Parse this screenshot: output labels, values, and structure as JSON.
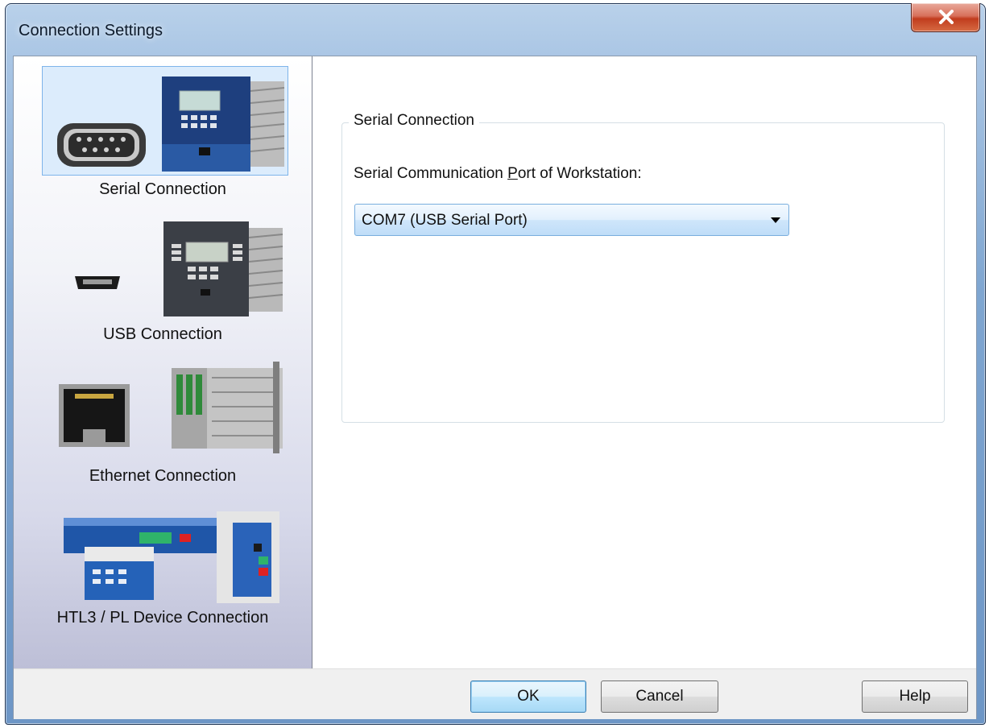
{
  "window": {
    "title": "Connection Settings"
  },
  "sidebar": {
    "items": [
      {
        "label": "Serial Connection",
        "selected": true,
        "icons": [
          "db9-connector-icon",
          "protection-relay-device-icon"
        ]
      },
      {
        "label": "USB Connection",
        "selected": false,
        "icons": [
          "mini-usb-connector-icon",
          "protection-relay-device-icon"
        ]
      },
      {
        "label": "Ethernet Connection",
        "selected": false,
        "icons": [
          "rj45-port-icon",
          "modular-relay-rack-icon"
        ]
      },
      {
        "label": "HTL3 / PL Device Connection",
        "selected": false,
        "icons": [
          "htl3-device-group-icon"
        ]
      }
    ]
  },
  "main": {
    "group_title": "Serial Connection",
    "port_label": "Serial Communication Port of Workstation:",
    "port_value": "COM7 (USB Serial Port)"
  },
  "footer": {
    "ok": "OK",
    "cancel": "Cancel",
    "help": "Help"
  },
  "colors": {
    "selection_bg": "#dcecfc",
    "selection_border": "#7eb4ea",
    "close_button": "#c13c1e"
  }
}
